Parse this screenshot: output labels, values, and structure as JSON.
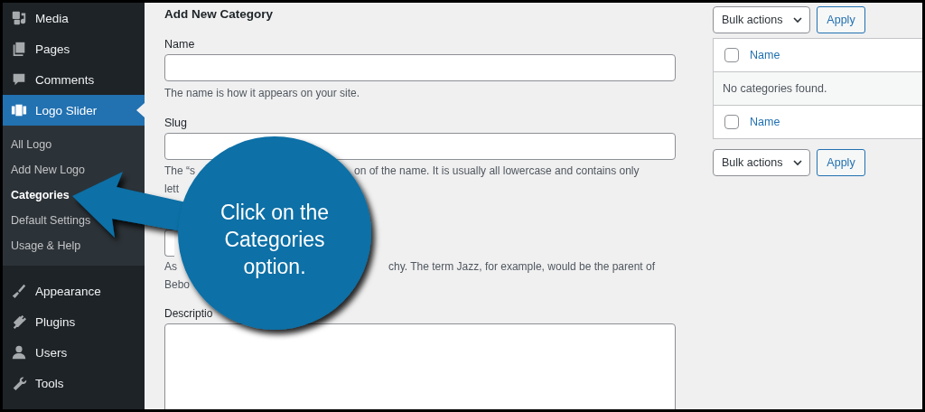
{
  "sidebar": {
    "items": [
      {
        "label": "Media",
        "current": false
      },
      {
        "label": "Pages",
        "current": false
      },
      {
        "label": "Comments",
        "current": false
      },
      {
        "label": "Logo Slider",
        "current": true,
        "children": [
          {
            "label": "All Logo",
            "selected": false
          },
          {
            "label": "Add New Logo",
            "selected": false
          },
          {
            "label": "Categories",
            "selected": true
          },
          {
            "label": "Default Settings",
            "selected": false
          },
          {
            "label": "Usage & Help",
            "selected": false
          }
        ]
      },
      {
        "label": "Appearance",
        "current": false
      },
      {
        "label": "Plugins",
        "current": false
      },
      {
        "label": "Users",
        "current": false
      },
      {
        "label": "Tools",
        "current": false
      }
    ]
  },
  "form": {
    "heading": "Add New Category",
    "name_label": "Name",
    "name_help": "The name is how it appears on your site.",
    "slug_label": "Slug",
    "slug_help_lines": [
      [
        "The “s",
        "on of the name. It is usually all lowercase and contains only"
      ],
      [
        "lett"
      ]
    ],
    "parent_help_lines": [
      [
        "As",
        "chy. The term Jazz, for example, would be the parent of"
      ],
      [
        "Bebo"
      ]
    ],
    "description_label": "Descriptio"
  },
  "table_panel": {
    "bulk_action": "Bulk actions",
    "apply": "Apply",
    "header": {
      "checked": false,
      "column": "Name"
    },
    "empty_message": "No categories found.",
    "footer": {
      "checked": false,
      "column": "Name"
    },
    "bottom_bulk_action": "Bulk actions",
    "bottom_apply": "Apply"
  },
  "callout": {
    "text": "Click on the Categories option."
  }
}
